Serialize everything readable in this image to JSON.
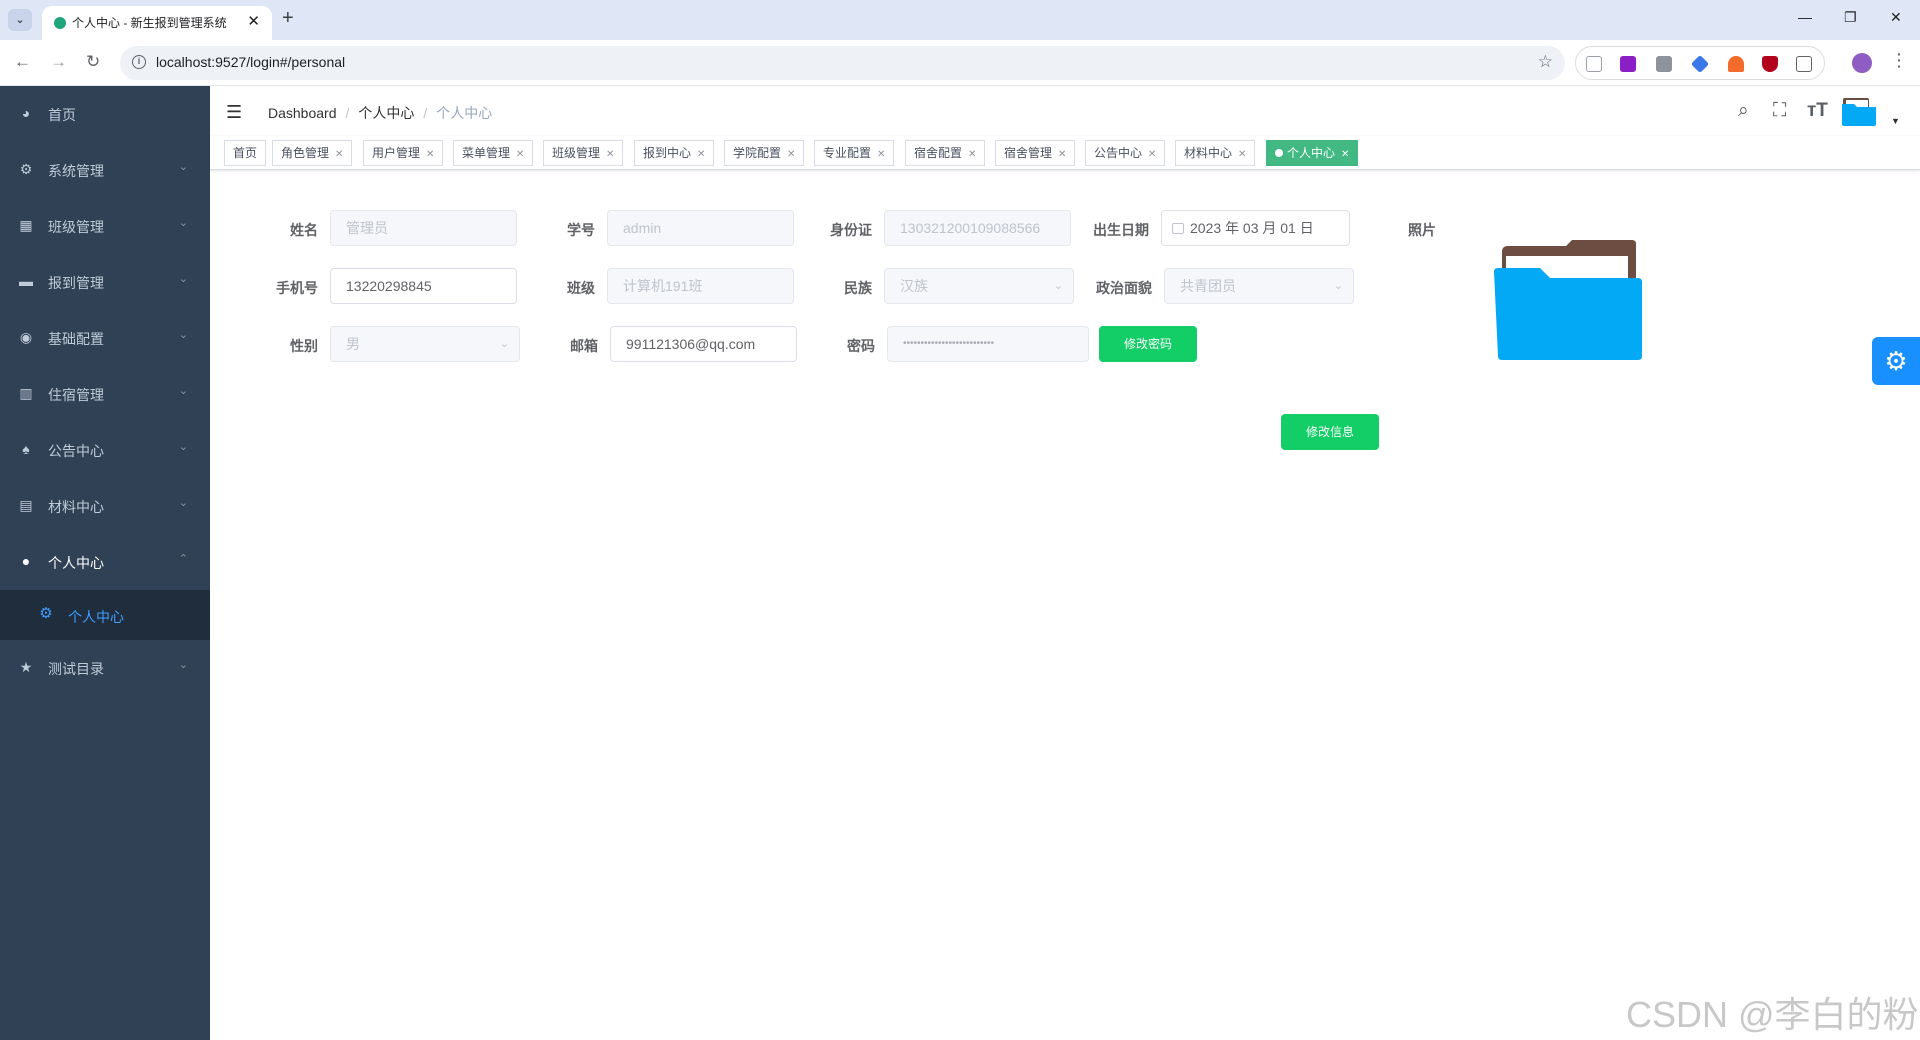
{
  "browser": {
    "tab_title": "个人中心 - 新生报到管理系统",
    "url": "localhost:9527/login#/personal"
  },
  "sidebar": {
    "items": [
      {
        "label": "首页",
        "icon": "dashboard-icon"
      },
      {
        "label": "系统管理",
        "icon": "gear-icon"
      },
      {
        "label": "班级管理",
        "icon": "grid-icon"
      },
      {
        "label": "报到管理",
        "icon": "monitor-icon"
      },
      {
        "label": "基础配置",
        "icon": "compass-icon"
      },
      {
        "label": "住宿管理",
        "icon": "chart-icon"
      },
      {
        "label": "公告中心",
        "icon": "bell-icon"
      },
      {
        "label": "材料中心",
        "icon": "clipboard-icon"
      },
      {
        "label": "个人中心",
        "icon": "user-icon"
      },
      {
        "label": "测试目录",
        "icon": "star-icon"
      }
    ],
    "sub_item": {
      "label": "个人中心",
      "icon": "gear-icon"
    }
  },
  "navbar": {
    "breadcrumb": [
      "Dashboard",
      "个人中心",
      "个人中心"
    ]
  },
  "tags": [
    "首页",
    "角色管理",
    "用户管理",
    "菜单管理",
    "班级管理",
    "报到中心",
    "学院配置",
    "专业配置",
    "宿舍配置",
    "宿舍管理",
    "公告中心",
    "材料中心",
    "个人中心"
  ],
  "form": {
    "name_label": "姓名",
    "name_value": "管理员",
    "student_no_label": "学号",
    "student_no_value": "admin",
    "id_card_label": "身份证",
    "id_card_value": "130321200109088566",
    "birth_label": "出生日期",
    "birth_value": "2023 年 03 月 01 日",
    "photo_label": "照片",
    "phone_label": "手机号",
    "phone_value": "13220298845",
    "class_label": "班级",
    "class_value": "计算机191班",
    "ethnic_label": "民族",
    "ethnic_value": "汉族",
    "political_label": "政治面貌",
    "political_value": "共青团员",
    "gender_label": "性别",
    "gender_value": "男",
    "email_label": "邮箱",
    "email_value": "991121306@qq.com",
    "password_label": "密码",
    "password_value": "••••••••••••••••••••••••••",
    "change_password_button": "修改密码",
    "update_info_button": "修改信息"
  },
  "watermark": "CSDN @李白的粉",
  "colors": {
    "sidebar_bg": "#304156",
    "sidebar_active_bg": "#1f2d3d",
    "accent_blue": "#409eff",
    "tag_active": "#42b983",
    "button_green": "#13ce66",
    "settings_blue": "#1890ff"
  }
}
